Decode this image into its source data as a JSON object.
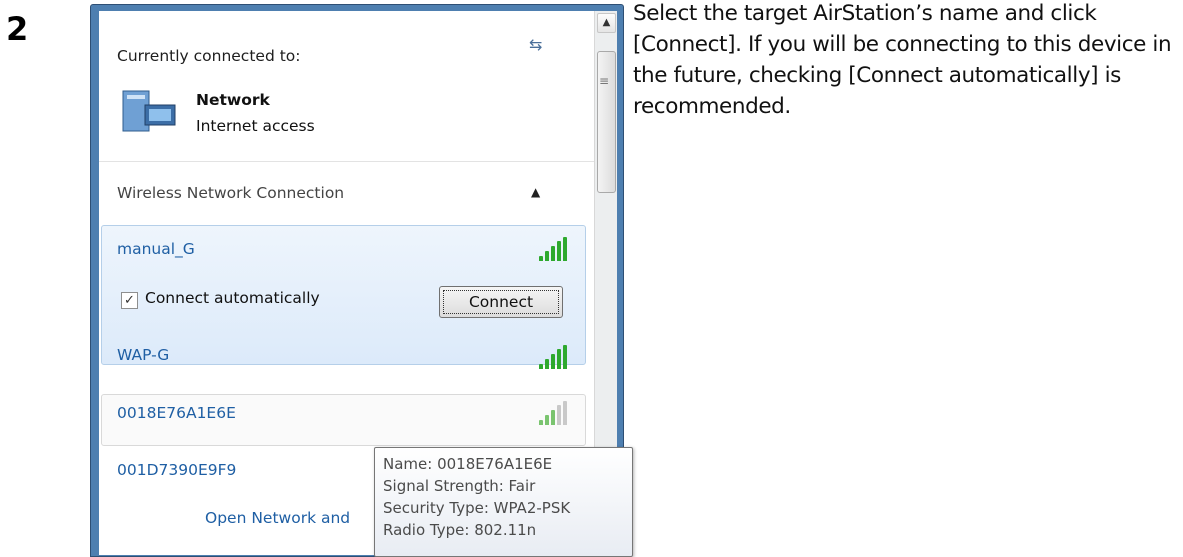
{
  "step": {
    "number": "2"
  },
  "instructions": "Select the target AirStation’s name and click [Connect]. If you will be connecting to this device in the future, checking [Connect automatically] is recommended.",
  "window": {
    "currently_connected_label": "Currently connected to:",
    "network": {
      "name": "Network",
      "status": "Internet access"
    },
    "section_header": "Wireless Network Connection",
    "networks": [
      {
        "ssid": "manual_G",
        "signal": "strong"
      },
      {
        "ssid": "WAP-G",
        "signal": "strong"
      },
      {
        "ssid": "0018E76A1E6E",
        "signal": "fair"
      },
      {
        "ssid": "001D7390E9F9",
        "signal": "unknown"
      }
    ],
    "connect_auto_label": "Connect automatically",
    "connect_auto_checked": true,
    "connect_button_label": "Connect",
    "bottom_link": "Open Network and",
    "colors": {
      "frame": "#4e7fb0",
      "link": "#1f5fa4",
      "signal": "#2ea92e"
    }
  },
  "tooltip": {
    "lines": [
      "Name: 0018E76A1E6E",
      "Signal Strength: Fair",
      "Security Type: WPA2-PSK",
      "Radio Type: 802.11n"
    ]
  }
}
